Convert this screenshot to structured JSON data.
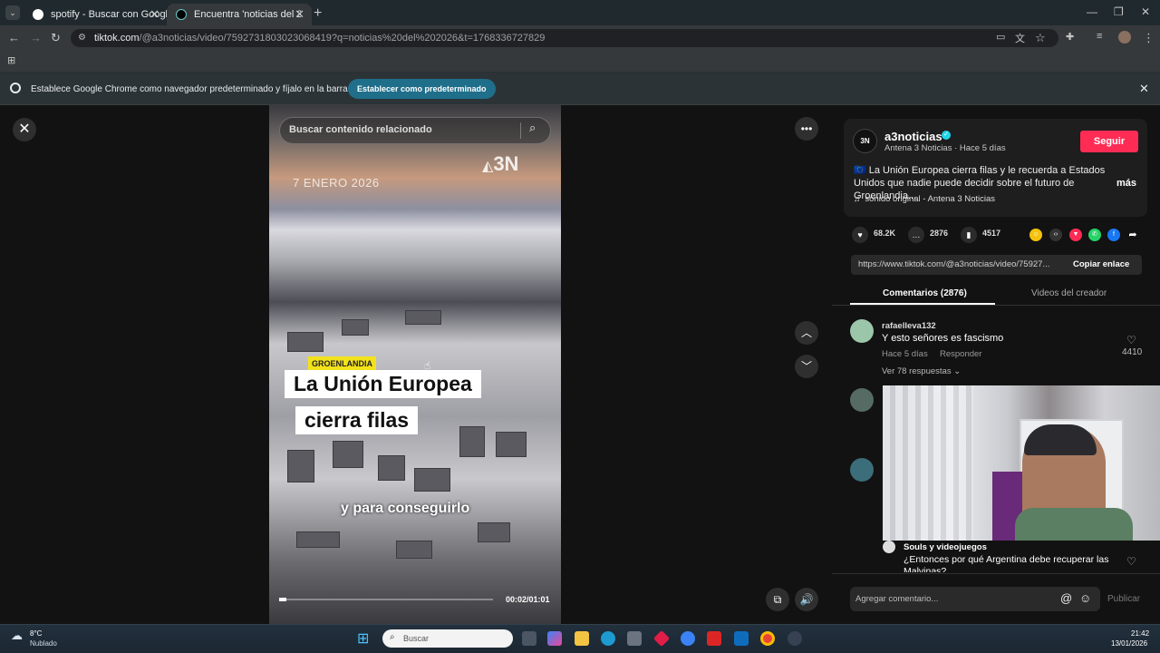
{
  "browser": {
    "tabs": [
      {
        "label": "spotify - Buscar con Google"
      },
      {
        "label": "Encuentra 'noticias del 2026' en"
      }
    ],
    "url_domain": "tiktok.com",
    "url_path": "/@a3noticias/video/7592731803023068419?q=noticias%20del%202026&t=1768336727829",
    "infobar": {
      "text": "Establece Google Chrome como navegador predeterminado y fíjalo en la barra de tareas",
      "button": "Establecer como predeterminado"
    }
  },
  "video": {
    "search_placeholder": "Buscar contenido relacionado",
    "logo": "3N",
    "date_overlay": "7 ENERO 2026",
    "tag": "GROENLANDIA",
    "headline_line1": "La Unión Europea",
    "headline_line2": "cierra filas",
    "subtitle": "y para conseguirlo",
    "time": "00:02/01:01",
    "progress": 0.033
  },
  "author": {
    "avatar_text": "3N",
    "name": "a3noticias",
    "meta": "Antena 3 Noticias · Hace 5 días",
    "follow_label": "Seguir",
    "description": "🇪🇺 La Unión Europea cierra filas y le recuerda a Estados Unidos que nadie puede decidir sobre el futuro de Groenlandia...",
    "more_label": "más",
    "sound": "sonido original - Antena 3 Noticias"
  },
  "stats": {
    "likes": "68.2K",
    "comments": "2876",
    "saves": "4517"
  },
  "link": {
    "url": "https://www.tiktok.com/@a3noticias/video/75927...",
    "copy_label": "Copiar enlace"
  },
  "panel_tabs": {
    "comments": "Comentarios (2876)",
    "creator_videos": "Videos del creador"
  },
  "comments": [
    {
      "user": "rafaelleva132",
      "text": "Y esto señores es fascismo",
      "time": "Hace 5 días",
      "reply": "Responder",
      "likes": "4410",
      "replies": "Ver 78 respuestas"
    },
    {
      "user": "Souls y videojuegos",
      "text": "¿Entonces por qué Argentina debe recuperar las Malvinas?"
    }
  ],
  "comment_box": {
    "placeholder": "Agregar comentario...",
    "publish": "Publicar"
  },
  "taskbar": {
    "weather_temp": "8°C",
    "weather_desc": "Nublado",
    "search_placeholder": "Buscar",
    "time": "21:42",
    "date": "13/01/2026"
  },
  "colors": {
    "accent_pink": "#fe2c55",
    "verified": "#20d5ec",
    "tag_yellow": "#f2e21b"
  }
}
